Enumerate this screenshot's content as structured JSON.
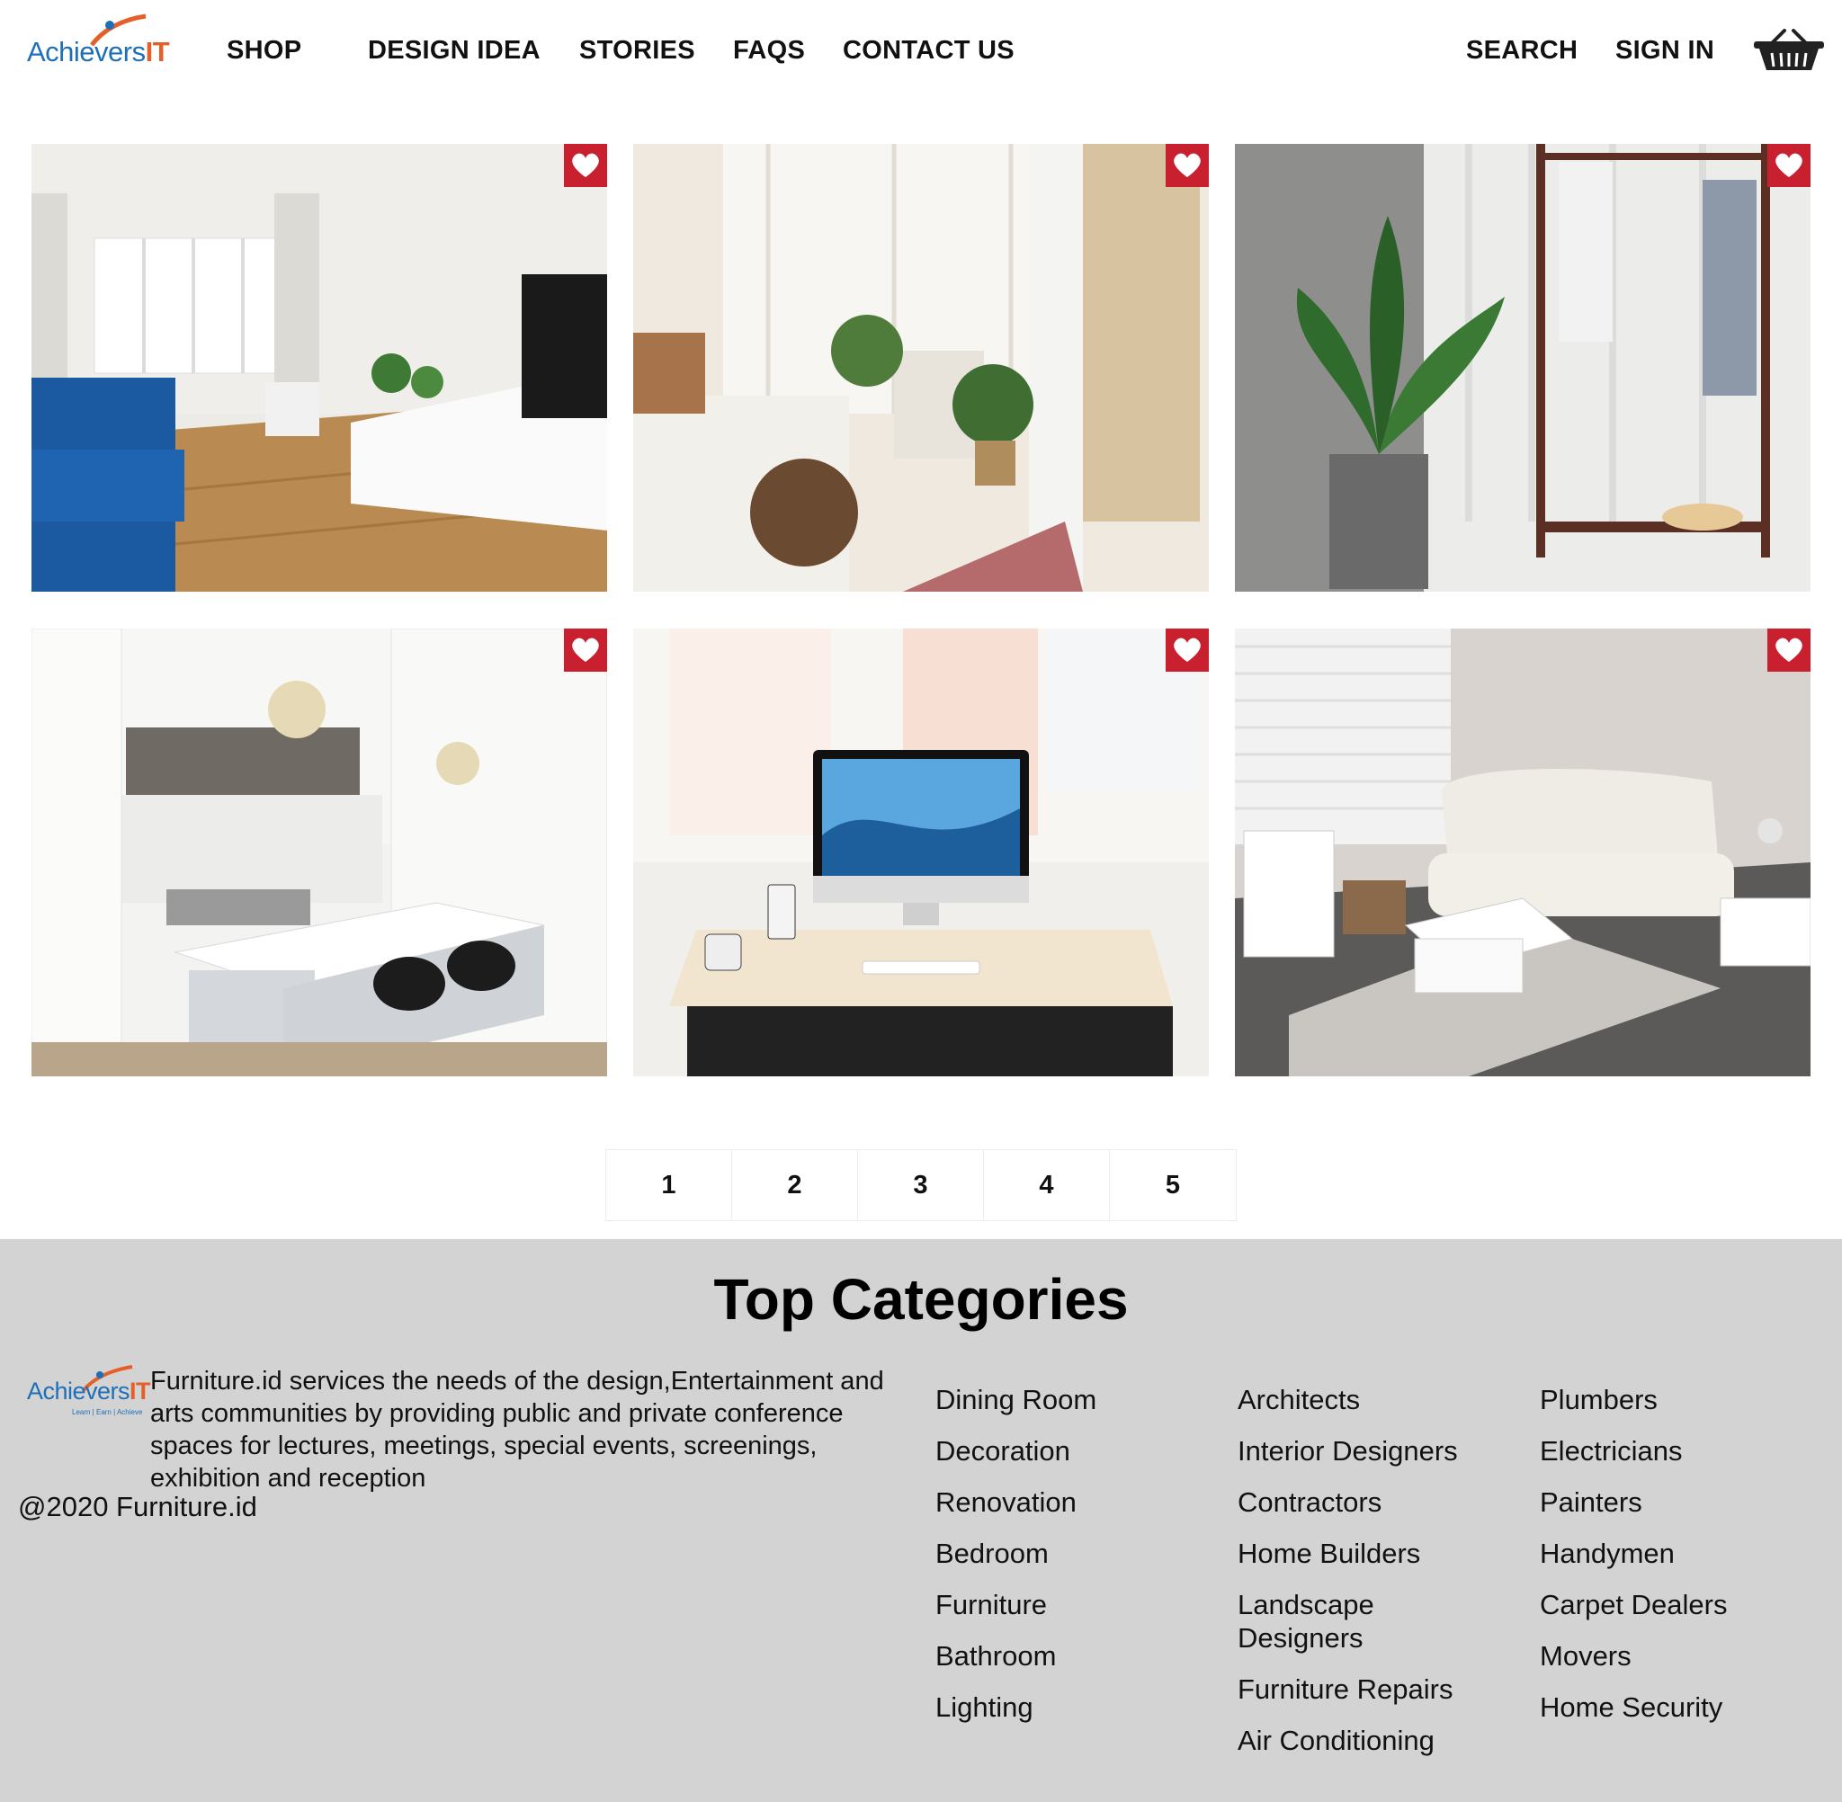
{
  "brand": {
    "logo_main": "Achievers",
    "logo_it": "IT",
    "logo_tagline": "Learn | Earn | Achieve"
  },
  "nav": {
    "items": [
      "SHOP",
      "DESIGN IDEA",
      "STORIES",
      "FAQS",
      "CONTACT US"
    ],
    "search": "SEARCH",
    "sign_in": "SIGN IN"
  },
  "icons": {
    "cart": "shopping-basket-icon",
    "favorite": "heart-icon"
  },
  "gallery": {
    "items": [
      {
        "subject": "living-room-blue-sofa"
      },
      {
        "subject": "bohemian-bedroom"
      },
      {
        "subject": "plant-and-clothes-rack"
      },
      {
        "subject": "white-kitchen-island"
      },
      {
        "subject": "desk-with-computer"
      },
      {
        "subject": "small-living-room"
      }
    ]
  },
  "pagination": {
    "pages": [
      "1",
      "2",
      "3",
      "4",
      "5"
    ]
  },
  "footer": {
    "title": "Top Categories",
    "about": "Furniture.id services the needs of the design,Entertainment and arts communities by providing public and private conference spaces for lectures, meetings, special events, screenings, exhibition and reception",
    "copyright": "@2020 Furniture.id",
    "columns": [
      [
        "Dining Room",
        "Decoration",
        "Renovation",
        "Bedroom",
        "Furniture",
        "Bathroom",
        "Lighting"
      ],
      [
        "Architects",
        "Interior Designers",
        "Contractors",
        "Home Builders",
        "Landscape Designers",
        "Furniture Repairs",
        "Air Conditioning"
      ],
      [
        "Plumbers",
        "Electricians",
        "Painters",
        "Handymen",
        "Carpet Dealers",
        "Movers",
        "Home Security"
      ]
    ]
  },
  "colors": {
    "accent_red": "#c8202f",
    "logo_blue": "#1d6fb8",
    "logo_orange": "#e4602a",
    "footer_bg": "#d3d3d3"
  }
}
